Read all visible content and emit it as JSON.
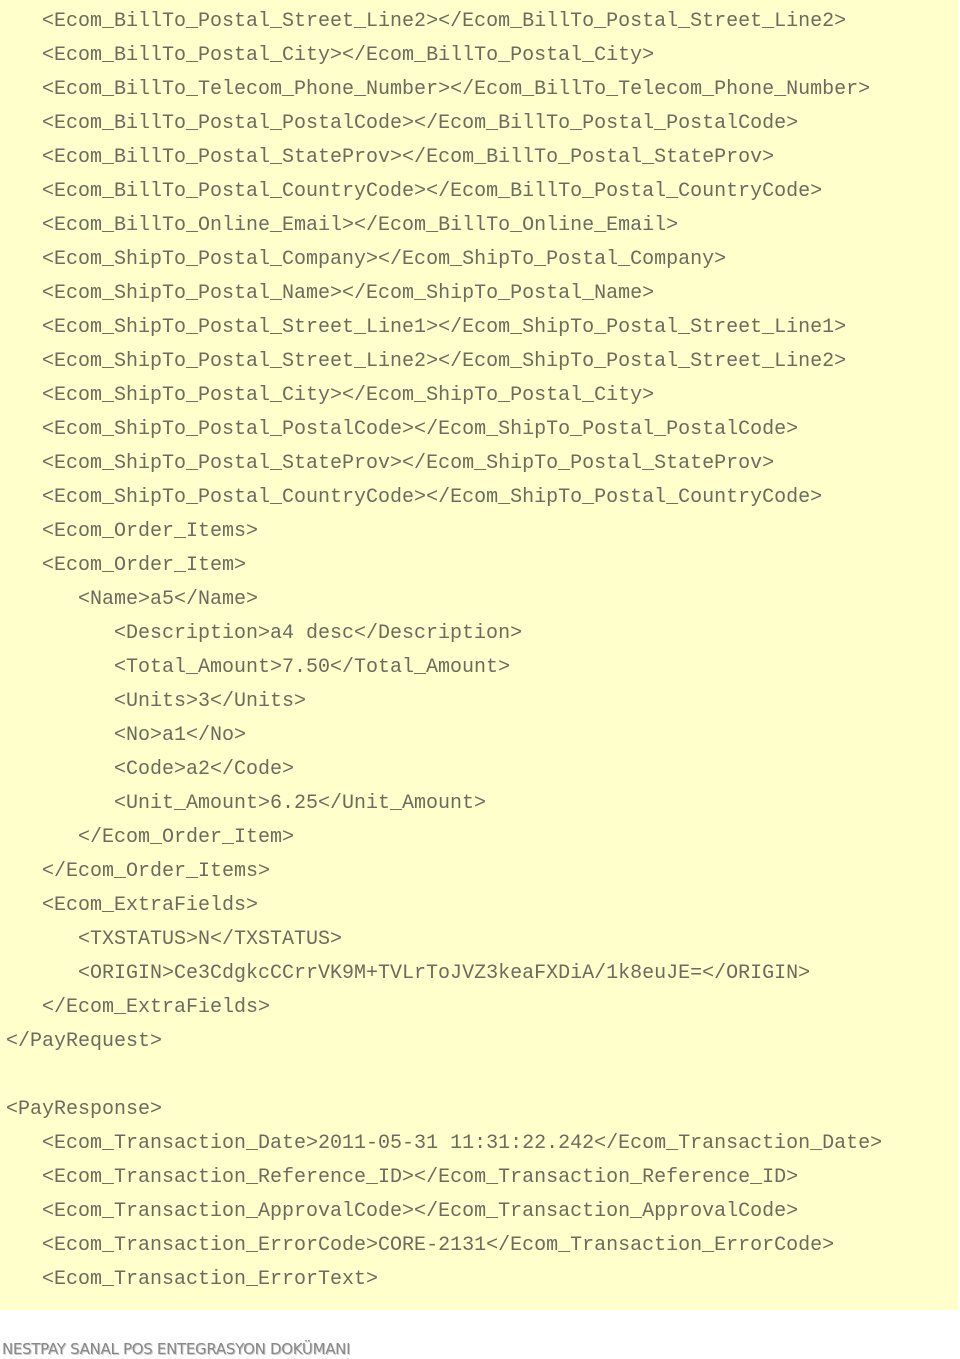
{
  "code_lines": [
    {
      "indent": 1,
      "text": "<Ecom_BillTo_Postal_Street_Line2></Ecom_BillTo_Postal_Street_Line2>"
    },
    {
      "indent": 1,
      "text": "<Ecom_BillTo_Postal_City></Ecom_BillTo_Postal_City>"
    },
    {
      "indent": 1,
      "text": "<Ecom_BillTo_Telecom_Phone_Number></Ecom_BillTo_Telecom_Phone_Number>"
    },
    {
      "indent": 1,
      "text": "<Ecom_BillTo_Postal_PostalCode></Ecom_BillTo_Postal_PostalCode>"
    },
    {
      "indent": 1,
      "text": "<Ecom_BillTo_Postal_StateProv></Ecom_BillTo_Postal_StateProv>"
    },
    {
      "indent": 1,
      "text": "<Ecom_BillTo_Postal_CountryCode></Ecom_BillTo_Postal_CountryCode>"
    },
    {
      "indent": 1,
      "text": "<Ecom_BillTo_Online_Email></Ecom_BillTo_Online_Email>"
    },
    {
      "indent": 1,
      "text": "<Ecom_ShipTo_Postal_Company></Ecom_ShipTo_Postal_Company>"
    },
    {
      "indent": 1,
      "text": "<Ecom_ShipTo_Postal_Name></Ecom_ShipTo_Postal_Name>"
    },
    {
      "indent": 1,
      "text": "<Ecom_ShipTo_Postal_Street_Line1></Ecom_ShipTo_Postal_Street_Line1>"
    },
    {
      "indent": 1,
      "text": "<Ecom_ShipTo_Postal_Street_Line2></Ecom_ShipTo_Postal_Street_Line2>"
    },
    {
      "indent": 1,
      "text": "<Ecom_ShipTo_Postal_City></Ecom_ShipTo_Postal_City>"
    },
    {
      "indent": 1,
      "text": "<Ecom_ShipTo_Postal_PostalCode></Ecom_ShipTo_Postal_PostalCode>"
    },
    {
      "indent": 1,
      "text": "<Ecom_ShipTo_Postal_StateProv></Ecom_ShipTo_Postal_StateProv>"
    },
    {
      "indent": 1,
      "text": "<Ecom_ShipTo_Postal_CountryCode></Ecom_ShipTo_Postal_CountryCode>"
    },
    {
      "indent": 1,
      "text": "<Ecom_Order_Items>"
    },
    {
      "indent": 1,
      "text": "<Ecom_Order_Item>"
    },
    {
      "indent": 2,
      "text": "<Name>a5</Name>"
    },
    {
      "indent": 3,
      "text": "<Description>a4 desc</Description>"
    },
    {
      "indent": 3,
      "text": "<Total_Amount>7.50</Total_Amount>"
    },
    {
      "indent": 3,
      "text": "<Units>3</Units>"
    },
    {
      "indent": 3,
      "text": "<No>a1</No>"
    },
    {
      "indent": 3,
      "text": "<Code>a2</Code>"
    },
    {
      "indent": 3,
      "text": "<Unit_Amount>6.25</Unit_Amount>"
    },
    {
      "indent": 2,
      "text": "</Ecom_Order_Item>"
    },
    {
      "indent": 1,
      "text": "</Ecom_Order_Items>"
    },
    {
      "indent": 1,
      "text": "<Ecom_ExtraFields>"
    },
    {
      "indent": 2,
      "text": "<TXSTATUS>N</TXSTATUS>"
    },
    {
      "indent": 2,
      "text": "<ORIGIN>Ce3CdgkcCCrrVK9M+TVLrToJVZ3keaFXDiA/1k8euJE=</ORIGIN>"
    },
    {
      "indent": 1,
      "text": "</Ecom_ExtraFields>"
    },
    {
      "indent": 0,
      "text": "</PayRequest>"
    },
    {
      "indent": 0,
      "text": ""
    },
    {
      "indent": 0,
      "text": "<PayResponse>"
    },
    {
      "indent": 1,
      "text": "<Ecom_Transaction_Date>2011-05-31 11:31:22.242</Ecom_Transaction_Date>"
    },
    {
      "indent": 1,
      "text": "<Ecom_Transaction_Reference_ID></Ecom_Transaction_Reference_ID>"
    },
    {
      "indent": 1,
      "text": "<Ecom_Transaction_ApprovalCode></Ecom_Transaction_ApprovalCode>"
    },
    {
      "indent": 1,
      "text": "<Ecom_Transaction_ErrorCode>CORE-2131</Ecom_Transaction_ErrorCode>"
    },
    {
      "indent": 1,
      "text": "<Ecom_Transaction_ErrorText>"
    }
  ],
  "footer": {
    "text": "NESTPAY SANAL POS ENTEGRASYON DOKÜMANI"
  },
  "colors": {
    "code_background": "#ffffcc",
    "code_text": "#6b6b5e"
  }
}
